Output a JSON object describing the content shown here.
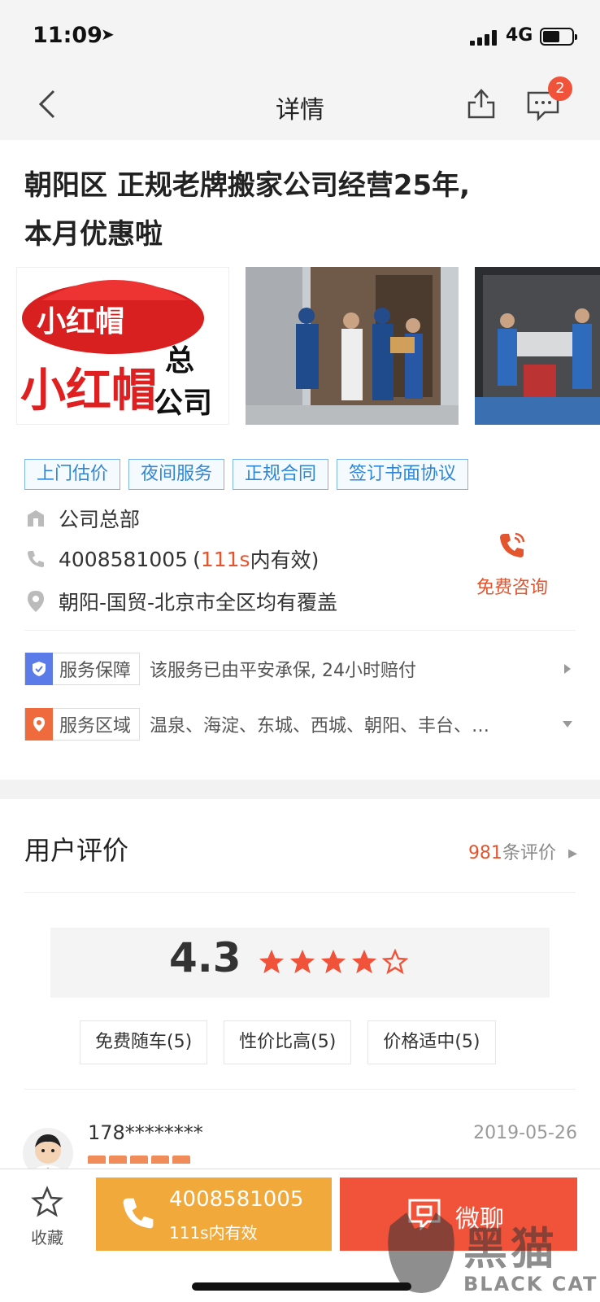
{
  "status": {
    "time": "11:09",
    "network": "4G"
  },
  "nav": {
    "title": "详情",
    "badge": "2"
  },
  "listing": {
    "title_line1": "朝阳区 正规老牌搬家公司经营25年,",
    "title_line2": "本月优惠啦",
    "logo_text_small": "小红帽",
    "logo_text_big": "小红帽",
    "logo_text_side1": "总",
    "logo_text_side2": "公司",
    "tags": [
      "上门估价",
      "夜间服务",
      "正规合同",
      "签订书面协议"
    ],
    "company": "公司总部",
    "phone": "4008581005",
    "valid_prefix": "(",
    "valid_num": "111s",
    "valid_suffix": "内有效)",
    "address": "朝阳-国贸-北京市全区均有覆盖",
    "consult_label": "免费咨询"
  },
  "services": {
    "guarantee_label": "服务保障",
    "guarantee_text": "该服务已由平安承保, 24小时赔付",
    "area_label": "服务区域",
    "area_text": "温泉、海淀、东城、西城、朝阳、丰台、…"
  },
  "reviews": {
    "title": "用户评价",
    "count_num": "981",
    "count_suffix": "条评价",
    "score": "4.3",
    "rating": 4.3,
    "chips": [
      "免费随车(5)",
      "性价比高(5)",
      "价格适中(5)"
    ],
    "first_user": {
      "name": "178********",
      "date": "2019-05-26"
    }
  },
  "bottom": {
    "fav_label": "收藏",
    "call_number": "4008581005",
    "call_sub": "111s内有效",
    "chat_label": "微聊"
  },
  "watermark": {
    "cn": "黑猫",
    "en": "BLACK CAT"
  },
  "colors": {
    "accent": "#e2552f",
    "tag_blue": "#2f86d6",
    "call_orange": "#f2a93b",
    "chat_red": "#f1533a",
    "star": "#f1533a"
  }
}
